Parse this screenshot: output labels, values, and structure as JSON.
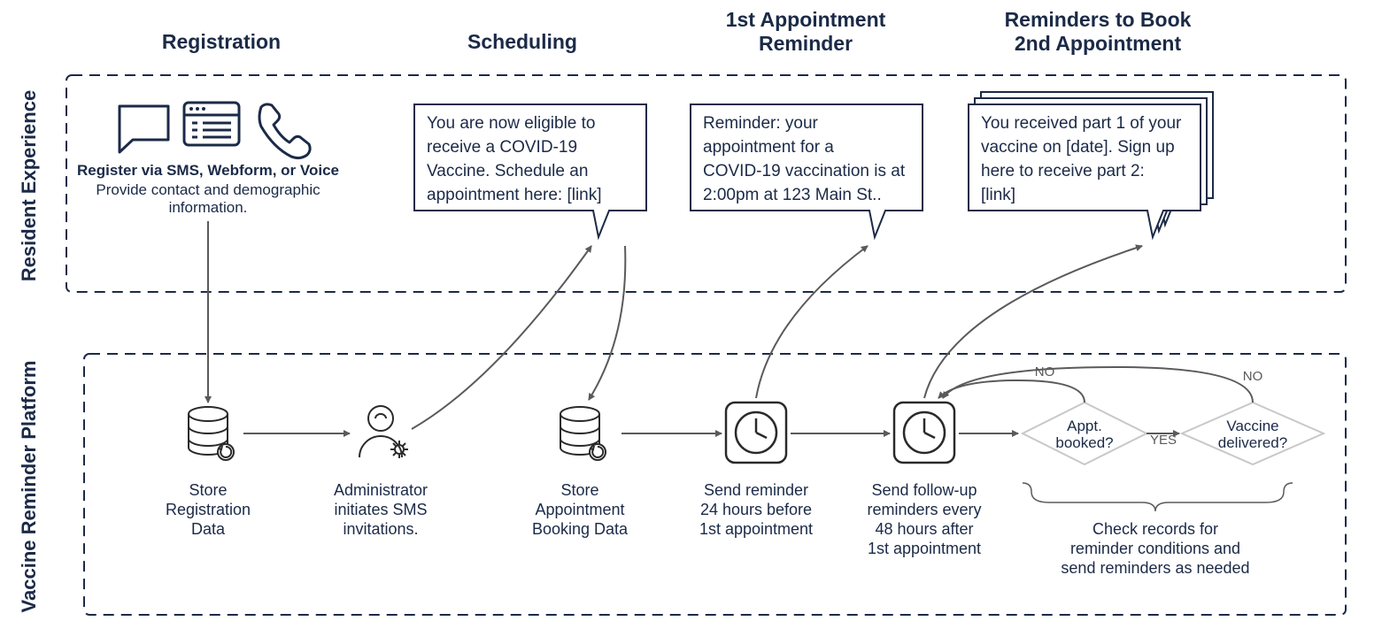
{
  "headers": {
    "registration": "Registration",
    "scheduling": "Scheduling",
    "reminder1_line1": "1st Appointment",
    "reminder1_line2": "Reminder",
    "reminder2_line1": "Reminders to Book",
    "reminder2_line2": "2nd Appointment"
  },
  "lanes": {
    "resident": "Resident Experience",
    "platform": "Vaccine Reminder Platform"
  },
  "resident": {
    "register_title": "Register via SMS, Webform, or Voice",
    "register_sub1": "Provide contact and demographic",
    "register_sub2": "information.",
    "scheduling_msg_l1": "You are now eligible to",
    "scheduling_msg_l2": "receive a COVID-19",
    "scheduling_msg_l3": "Vaccine. Schedule an",
    "scheduling_msg_l4": "appointment here: [link]",
    "reminder1_msg_l1": "Reminder: your",
    "reminder1_msg_l2": "appointment for a",
    "reminder1_msg_l3": "COVID-19 vaccination is at",
    "reminder1_msg_l4": "2:00pm at 123 Main St..",
    "reminder2_msg_l1": "You received part 1 of your",
    "reminder2_msg_l2": "vaccine on [date]. Sign up",
    "reminder2_msg_l3": "here to receive part 2:",
    "reminder2_msg_l4": "[link]"
  },
  "platform": {
    "store_reg_l1": "Store",
    "store_reg_l2": "Registration",
    "store_reg_l3": "Data",
    "admin_l1": "Administrator",
    "admin_l2": "initiates SMS",
    "admin_l3": "invitations.",
    "store_appt_l1": "Store",
    "store_appt_l2": "Appointment",
    "store_appt_l3": "Booking Data",
    "send24_l1": "Send reminder",
    "send24_l2": "24 hours before",
    "send24_l3": "1st appointment",
    "send48_l1": "Send follow-up",
    "send48_l2": "reminders every",
    "send48_l3": "48 hours after",
    "send48_l4": "1st appointment",
    "dec1_l1": "Appt.",
    "dec1_l2": "booked?",
    "dec2_l1": "Vaccine",
    "dec2_l2": "delivered?",
    "no": "NO",
    "yes": "YES",
    "check_l1": "Check records for",
    "check_l2": "reminder conditions and",
    "check_l3": "send reminders as needed"
  }
}
